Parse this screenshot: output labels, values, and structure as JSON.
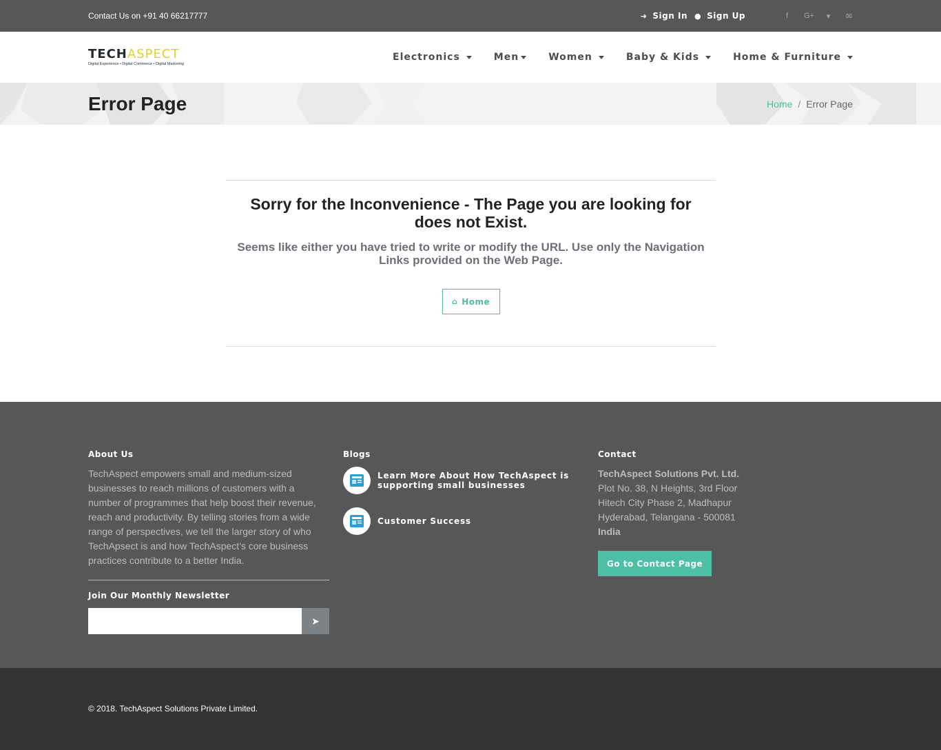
{
  "topbar": {
    "contact": "Contact Us on +91 40 66217777",
    "sign_in": "Sign In",
    "sign_up": "Sign Up",
    "social_icons": [
      "facebook-icon",
      "google-plus-icon",
      "twitter-icon",
      "email-icon"
    ]
  },
  "logo": {
    "tech": "TECH",
    "aspect": "ASPECT",
    "tagline": "Digital Experience • Digital Commerce • Digital Marketing"
  },
  "nav": {
    "items": [
      {
        "label": "Electronics"
      },
      {
        "label": "Men"
      },
      {
        "label": "Women"
      },
      {
        "label": "Baby & Kids"
      },
      {
        "label": "Home & Furniture"
      }
    ]
  },
  "page": {
    "title": "Error Page",
    "breadcrumb_home": "Home",
    "breadcrumb_sep": "/",
    "breadcrumb_current": "Error Page"
  },
  "error": {
    "heading": "Sorry for the Inconvenience - The Page you are looking for does not Exist.",
    "message": "Seems like either you have tried to write or modify the URL. Use only the Navigation Links provided on the Web Page.",
    "home_button": "Home"
  },
  "footer": {
    "about_title": "About Us",
    "about_text": "TechAspect empowers small and medium-sized businesses to reach millions of customers with a number of programmes that help boost their revenue, reach and productivity. By telling stories from a wide range of perspectives, we tell the larger story of who TechApsect is and how TechAspect's core business practices contribute to a better India.",
    "newsletter_title": "Join Our Monthly Newsletter",
    "newsletter_value": "",
    "blogs_title": "Blogs",
    "blogs": [
      {
        "title": "Learn More About How TechAspect is supporting small businesses"
      },
      {
        "title": "Customer Success"
      }
    ],
    "contact_title": "Contact",
    "contact_company": "TechAspect Solutions Pvt. Ltd.",
    "contact_line1": "Plot No. 38, N Heights, 3rd Floor",
    "contact_line2": "Hitech City Phase 2, Madhapur",
    "contact_line3": "Hyderabad, Telangana - 500081",
    "contact_country": "India",
    "contact_button": "Go to Contact Page"
  },
  "copyright": "© 2018. TechAspect Solutions Private Limited.",
  "colors": {
    "accent": "#4cbfa6",
    "topbar": "#575757",
    "footer": "#575757",
    "copyright_bar": "#333333",
    "logo_yellow": "#e3d41b"
  }
}
